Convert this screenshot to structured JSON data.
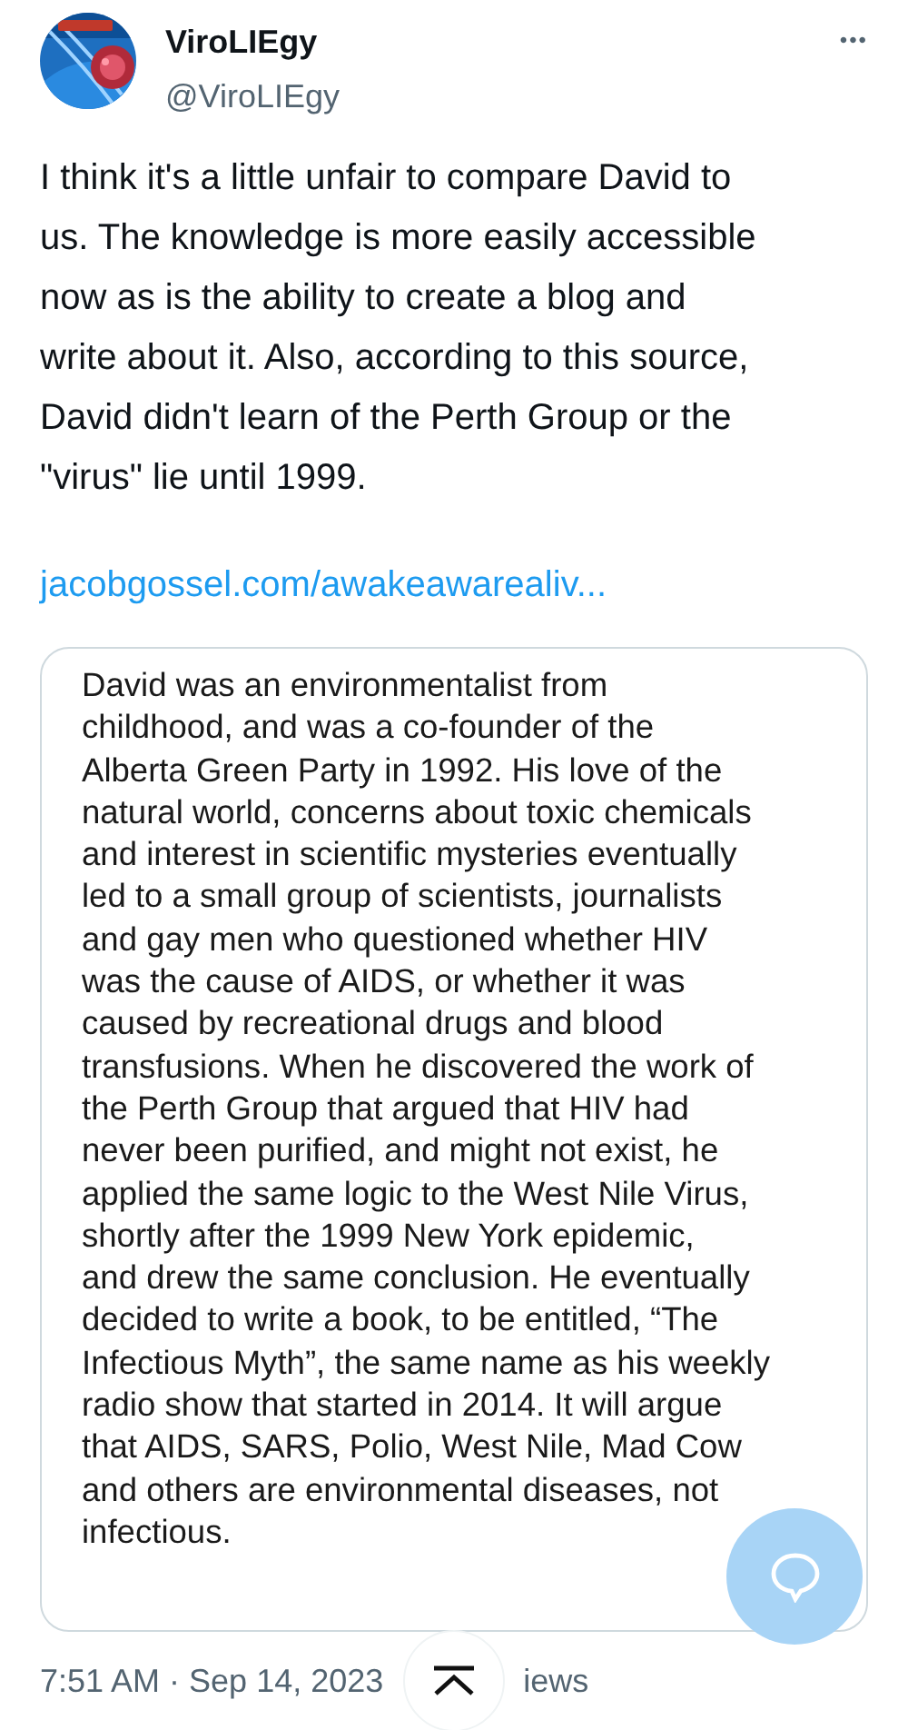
{
  "author": {
    "name": "ViroLIEgy",
    "handle": "@ViroLIEgy"
  },
  "more_button": "•••",
  "tweet_lines": [
    "I think it's a little unfair to compare David to",
    "us. The knowledge is more easily accessible",
    "now as is the ability to create a blog and",
    "write about it. Also, according to this source,",
    "David didn't learn of the Perth Group or the",
    "\"virus\" lie until 1999."
  ],
  "link": "jacobgossel.com/awakeawarealiv...",
  "image_lines": [
    "David was an environmentalist from",
    "childhood, and was a co-founder of the",
    "Alberta Green Party in 1992. His love of the",
    "natural world, concerns about toxic chemicals",
    "and interest in scientific mysteries eventually",
    "led to a small group of scientists, journalists",
    "and gay men who questioned whether HIV",
    "was the cause of AIDS, or whether it was",
    "caused by recreational drugs and blood",
    "transfusions. When he discovered the work of",
    "the Perth Group that argued that HIV had",
    "never been purified, and might not exist, he",
    "applied the same logic to the West Nile Virus,",
    "shortly after the 1999 New York epidemic,",
    "and drew the same conclusion. He eventually",
    "decided to write a book, to be entitled, “The",
    "Infectious Myth”, the same name as his weekly",
    "radio show that started in 2014. It will argue",
    "that AIDS, SARS, Polio, West Nile, Mad Cow",
    "and others are environmental diseases, not",
    "infectious."
  ],
  "timestamp": "7:51 AM · Sep 14, 2023",
  "views_fragment": "iews"
}
